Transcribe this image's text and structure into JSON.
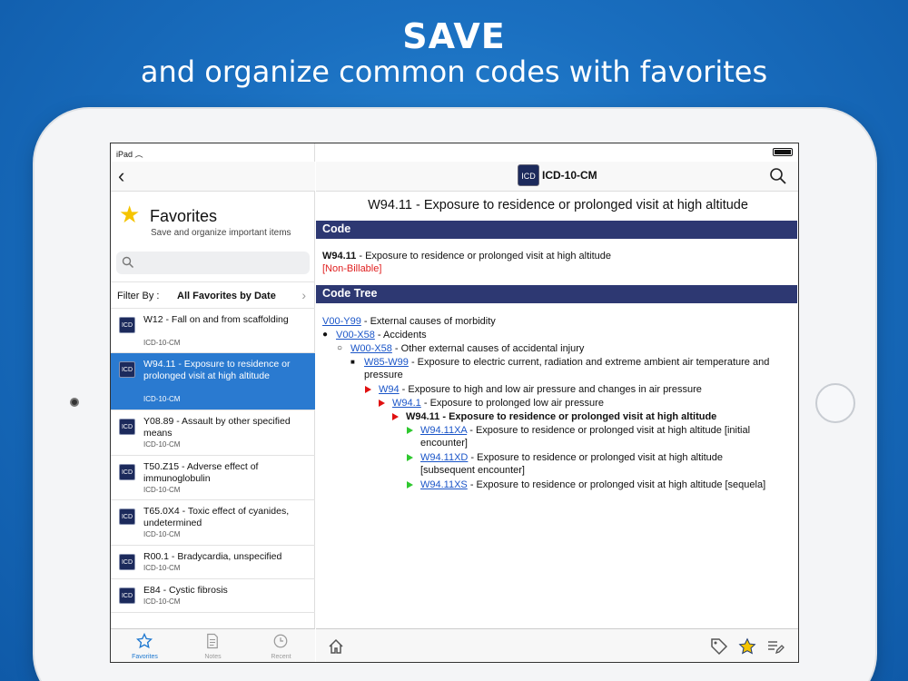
{
  "headline": {
    "line1": "SAVE",
    "line2": "and organize common codes with favorites"
  },
  "status": {
    "carrier": "iPad"
  },
  "nav": {
    "app_logo": "ICD",
    "app_title": "ICD-10-CM"
  },
  "favorites": {
    "title": "Favorites",
    "subtitle": "Save and organize important items",
    "search_placeholder": "",
    "filter_label": "Filter By :",
    "filter_value": "All Favorites by Date",
    "items": [
      {
        "title": "W12 - Fall on and from scaffolding",
        "sub": "ICD-10-CM",
        "selected": false
      },
      {
        "title": "W94.11 - Exposure to residence or prolonged visit at high altitude",
        "sub": "ICD-10-CM",
        "selected": true
      },
      {
        "title": "Y08.89 - Assault by other specified means",
        "sub": "ICD-10-CM",
        "selected": false
      },
      {
        "title": "T50.Z15 - Adverse effect of immunoglobulin",
        "sub": "ICD-10-CM",
        "selected": false
      },
      {
        "title": "T65.0X4 - Toxic effect of cyanides, undetermined",
        "sub": "ICD-10-CM",
        "selected": false
      },
      {
        "title": "R00.1 - Bradycardia, unspecified",
        "sub": "ICD-10-CM",
        "selected": false
      },
      {
        "title": "E84 - Cystic fibrosis",
        "sub": "ICD-10-CM",
        "selected": false
      }
    ]
  },
  "tabs": [
    {
      "label": "Favorites",
      "icon": "star-icon",
      "active": true
    },
    {
      "label": "Notes",
      "icon": "notes-icon",
      "active": false
    },
    {
      "label": "Recent",
      "icon": "clock-icon",
      "active": false
    }
  ],
  "detail": {
    "title": "W94.11 - Exposure to residence or prolonged visit at high altitude",
    "code_heading": "Code",
    "code": "W94.11",
    "code_desc": " - Exposure to residence or prolonged visit at high altitude",
    "billable": "[Non-Billable]",
    "tree_heading": "Code Tree",
    "tree": [
      {
        "code": "V00-Y99",
        "desc": " - External causes of morbidity"
      },
      {
        "code": "V00-X58",
        "desc": " - Accidents"
      },
      {
        "code": "W00-X58",
        "desc": " - Other external causes of accidental injury"
      },
      {
        "code": "W85-W99",
        "desc": " - Exposure to electric current, radiation and extreme ambient air temperature and",
        "desc2": "pressure"
      },
      {
        "code": "W94",
        "desc": " - Exposure to high and low air pressure and changes in air pressure"
      },
      {
        "code": "W94.1",
        "desc": " - Exposure to prolonged low air pressure"
      },
      {
        "code": "W94.11",
        "desc": " - Exposure to residence or prolonged visit at high altitude"
      },
      {
        "code": "W94.11XA",
        "desc": " - Exposure to residence or prolonged visit at high altitude [initial",
        "desc2": "encounter]"
      },
      {
        "code": "W94.11XD",
        "desc": " - Exposure to residence or prolonged visit at high altitude",
        "desc2": "[subsequent encounter]"
      },
      {
        "code": "W94.11XS",
        "desc": " - Exposure to residence or prolonged visit at high altitude [sequela]"
      }
    ]
  },
  "colors": {
    "background": "#1a6fc0",
    "section_header": "#2d3872",
    "selected_row": "#2a7ad0",
    "link": "#1a55c8",
    "billable": "#e02020",
    "star": "#f5c400"
  }
}
